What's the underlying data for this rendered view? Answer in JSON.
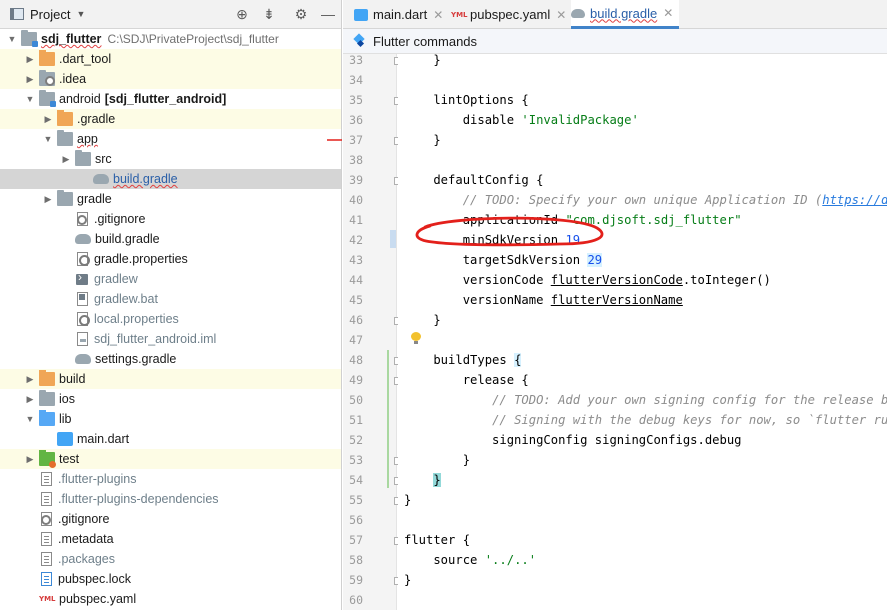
{
  "project_panel": {
    "title": "Project",
    "tree": [
      {
        "label": "sdj_flutter",
        "path": "C:\\SDJ\\PrivateProject\\sdj_flutter",
        "icon": "folder-module-icon",
        "depth": 0,
        "expanded": true,
        "bold": true,
        "wavy": true
      },
      {
        "label": ".dart_tool",
        "icon": "folder-orange-icon",
        "depth": 1,
        "collapsed": true,
        "hl": "yellow"
      },
      {
        "label": ".idea",
        "icon": "folder-gear-icon",
        "depth": 1,
        "collapsed": true,
        "hl": "yellow"
      },
      {
        "label": "android",
        "extra": "[sdj_flutter_android]",
        "icon": "folder-module-icon",
        "depth": 1,
        "expanded": true
      },
      {
        "label": ".gradle",
        "icon": "folder-orange-icon",
        "depth": 2,
        "collapsed": true,
        "hl": "yellow"
      },
      {
        "label": "app",
        "icon": "folder-gray-icon",
        "depth": 2,
        "expanded": true,
        "wavy": true
      },
      {
        "label": "src",
        "icon": "folder-gray-icon",
        "depth": 3,
        "collapsed": true
      },
      {
        "label": "build.gradle",
        "icon": "gradle-file-icon",
        "depth": 4,
        "selected": true,
        "wavy": true
      },
      {
        "label": "gradle",
        "icon": "folder-gray-icon",
        "depth": 2,
        "collapsed": true
      },
      {
        "label": ".gitignore",
        "icon": "gitignore-file-icon",
        "depth": 3
      },
      {
        "label": "build.gradle",
        "icon": "gradle-file-icon",
        "depth": 3
      },
      {
        "label": "gradle.properties",
        "icon": "properties-file-icon",
        "depth": 3
      },
      {
        "label": "gradlew",
        "icon": "terminal-file-icon",
        "depth": 3,
        "muted": true
      },
      {
        "label": "gradlew.bat",
        "icon": "bat-file-icon",
        "depth": 3,
        "muted": true
      },
      {
        "label": "local.properties",
        "icon": "properties-file-icon",
        "depth": 3,
        "muted": true
      },
      {
        "label": "sdj_flutter_android.iml",
        "icon": "iml-file-icon",
        "depth": 3,
        "muted": true
      },
      {
        "label": "settings.gradle",
        "icon": "gradle-file-icon",
        "depth": 3
      },
      {
        "label": "build",
        "icon": "folder-orange-icon",
        "depth": 1,
        "collapsed": true,
        "hl": "yellow"
      },
      {
        "label": "ios",
        "icon": "folder-gray-icon",
        "depth": 1,
        "collapsed": true
      },
      {
        "label": "lib",
        "icon": "folder-blue-icon",
        "depth": 1,
        "expanded": true
      },
      {
        "label": "main.dart",
        "icon": "dart-file-icon",
        "depth": 2
      },
      {
        "label": "test",
        "icon": "folder-test-icon",
        "depth": 1,
        "collapsed": true,
        "hl": "yellow"
      },
      {
        "label": ".flutter-plugins",
        "icon": "text-file-icon",
        "depth": 1,
        "muted": true
      },
      {
        "label": ".flutter-plugins-dependencies",
        "icon": "text-file-icon",
        "depth": 1,
        "muted": true
      },
      {
        "label": ".gitignore",
        "icon": "gitignore-file-icon",
        "depth": 1
      },
      {
        "label": ".metadata",
        "icon": "text-file-icon",
        "depth": 1
      },
      {
        "label": ".packages",
        "icon": "text-file-icon",
        "depth": 1,
        "muted": true
      },
      {
        "label": "pubspec.lock",
        "icon": "lock-file-icon",
        "depth": 1
      },
      {
        "label": "pubspec.yaml",
        "icon": "yaml-file-icon",
        "depth": 1
      }
    ]
  },
  "editor": {
    "tabs": [
      {
        "label": "main.dart",
        "icon": "dart-file-icon",
        "active": false
      },
      {
        "label": "pubspec.yaml",
        "icon": "yaml-file-icon",
        "active": false
      },
      {
        "label": "build.gradle",
        "icon": "gradle-file-icon",
        "active": true
      }
    ],
    "toolbar_label": "Flutter commands",
    "code_lines": [
      {
        "n": "33",
        "html": "    }"
      },
      {
        "n": "34",
        "html": ""
      },
      {
        "n": "35",
        "html": "    lintOptions {"
      },
      {
        "n": "36",
        "html": "        disable <span class='str'>'InvalidPackage'</span>"
      },
      {
        "n": "37",
        "html": "    }"
      },
      {
        "n": "38",
        "html": ""
      },
      {
        "n": "39",
        "html": "    defaultConfig {"
      },
      {
        "n": "40",
        "html": "        <span class='cmt'>// TODO: Specify your own unique Application ID (<span class='link'>https://deve</span></span>"
      },
      {
        "n": "41",
        "html": "        applicationId <span class='str'>\"com.djsoft.sdj_flutter\"</span>"
      },
      {
        "n": "42",
        "html": "        minSdkVersion <span class='num'>19</span>"
      },
      {
        "n": "43",
        "html": "        targetSdkVersion <span class='num brace-hl'>29</span>"
      },
      {
        "n": "44",
        "html": "        versionCode <span class='ul'>flutterVersionCode</span>.toInteger()"
      },
      {
        "n": "45",
        "html": "        versionName <span class='ul'>flutterVersionName</span>"
      },
      {
        "n": "46",
        "html": "    }"
      },
      {
        "n": "47",
        "html": ""
      },
      {
        "n": "48",
        "html": "    buildTypes <span class='brace-hl'>{</span>"
      },
      {
        "n": "49",
        "html": "        release {"
      },
      {
        "n": "50",
        "html": "            <span class='cmt'>// TODO: Add your own signing config for the release buil</span>"
      },
      {
        "n": "51",
        "html": "            <span class='cmt'>// Signing with the debug keys for now, so `flutter run -</span>"
      },
      {
        "n": "52",
        "html": "            signingConfig signingConfigs.debug"
      },
      {
        "n": "53",
        "html": "        }"
      },
      {
        "n": "54",
        "html": "    <span class='brace-box'>}</span>"
      },
      {
        "n": "55",
        "html": "}"
      },
      {
        "n": "56",
        "html": ""
      },
      {
        "n": "57",
        "html": "flutter {"
      },
      {
        "n": "58",
        "html": "    source <span class='str'>'../..'</span>"
      },
      {
        "n": "59",
        "html": "}"
      },
      {
        "n": "60",
        "html": ""
      }
    ]
  },
  "colors": {
    "annotation": "#e3201b",
    "selection": "#d5d5d5",
    "ignored_highlight": "#fdfce5"
  }
}
